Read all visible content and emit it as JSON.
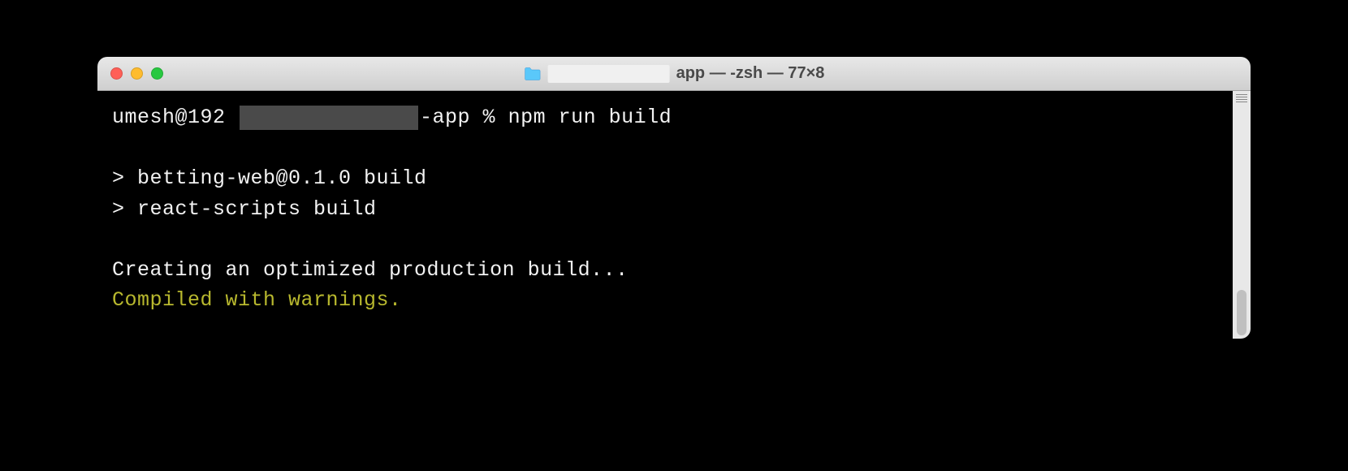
{
  "window": {
    "title_suffix": "app — -zsh — 77×8"
  },
  "terminal": {
    "prompt_prefix": "umesh@192 ",
    "prompt_suffix": "-app % ",
    "command": "npm run build",
    "output": {
      "line1": "> betting-web@0.1.0 build",
      "line2": "> react-scripts build",
      "line3": "Creating an optimized production build...",
      "warning": "Compiled with warnings."
    }
  }
}
